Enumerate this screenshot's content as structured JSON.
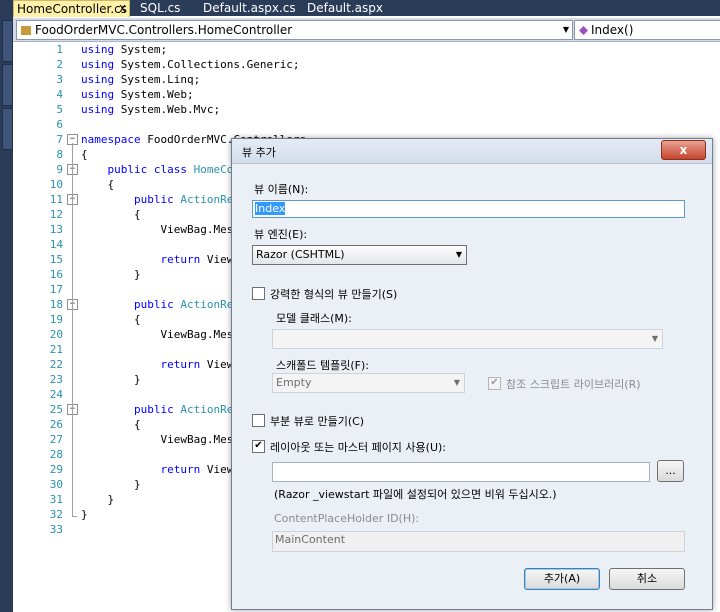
{
  "tabs": [
    {
      "label": "HomeController.cs",
      "close": "x"
    },
    {
      "label": "SQL.cs"
    },
    {
      "label": "Default.aspx.cs"
    },
    {
      "label": "Default.aspx"
    }
  ],
  "nav": {
    "class_dropdown": "FoodOrderMVC.Controllers.HomeController",
    "member_dropdown": "Index()"
  },
  "editor": {
    "lines": [
      {
        "n": "1",
        "indent": "",
        "parts": [
          {
            "t": "using",
            "c": "kw"
          },
          {
            "t": " System;"
          }
        ]
      },
      {
        "n": "2",
        "indent": "",
        "parts": [
          {
            "t": "using",
            "c": "kw"
          },
          {
            "t": " System.Collections.Generic;"
          }
        ]
      },
      {
        "n": "3",
        "indent": "",
        "parts": [
          {
            "t": "using",
            "c": "kw"
          },
          {
            "t": " System.Linq;"
          }
        ]
      },
      {
        "n": "4",
        "indent": "",
        "parts": [
          {
            "t": "using",
            "c": "kw"
          },
          {
            "t": " System.Web;"
          }
        ]
      },
      {
        "n": "5",
        "indent": "",
        "parts": [
          {
            "t": "using",
            "c": "kw"
          },
          {
            "t": " System.Web.Mvc;"
          }
        ]
      },
      {
        "n": "6",
        "indent": "",
        "parts": []
      },
      {
        "n": "7",
        "indent": "",
        "parts": [
          {
            "t": "namespace",
            "c": "kw"
          },
          {
            "t": " FoodOrderMVC.Controllers"
          }
        ]
      },
      {
        "n": "8",
        "indent": "",
        "parts": [
          {
            "t": "{"
          }
        ]
      },
      {
        "n": "9",
        "indent": "    ",
        "parts": [
          {
            "t": "public",
            "c": "kw"
          },
          {
            "t": " "
          },
          {
            "t": "class",
            "c": "kw"
          },
          {
            "t": " "
          },
          {
            "t": "HomeCo",
            "c": "ty"
          }
        ]
      },
      {
        "n": "10",
        "indent": "    ",
        "parts": [
          {
            "t": "{"
          }
        ]
      },
      {
        "n": "11",
        "indent": "        ",
        "parts": [
          {
            "t": "public",
            "c": "kw"
          },
          {
            "t": " "
          },
          {
            "t": "ActionRe",
            "c": "ty"
          }
        ]
      },
      {
        "n": "12",
        "indent": "        ",
        "parts": [
          {
            "t": "{"
          }
        ]
      },
      {
        "n": "13",
        "indent": "            ",
        "parts": [
          {
            "t": "ViewBag.Mes"
          }
        ]
      },
      {
        "n": "14",
        "indent": "",
        "parts": []
      },
      {
        "n": "15",
        "indent": "            ",
        "parts": [
          {
            "t": "return",
            "c": "kw"
          },
          {
            "t": " View"
          }
        ]
      },
      {
        "n": "16",
        "indent": "        ",
        "parts": [
          {
            "t": "}"
          }
        ]
      },
      {
        "n": "17",
        "indent": "",
        "parts": []
      },
      {
        "n": "18",
        "indent": "        ",
        "parts": [
          {
            "t": "public",
            "c": "kw"
          },
          {
            "t": " "
          },
          {
            "t": "ActionRe",
            "c": "ty"
          }
        ]
      },
      {
        "n": "19",
        "indent": "        ",
        "parts": [
          {
            "t": "{"
          }
        ]
      },
      {
        "n": "20",
        "indent": "            ",
        "parts": [
          {
            "t": "ViewBag.Mes"
          }
        ]
      },
      {
        "n": "21",
        "indent": "",
        "parts": []
      },
      {
        "n": "22",
        "indent": "            ",
        "parts": [
          {
            "t": "return",
            "c": "kw"
          },
          {
            "t": " View"
          }
        ]
      },
      {
        "n": "23",
        "indent": "        ",
        "parts": [
          {
            "t": "}"
          }
        ]
      },
      {
        "n": "24",
        "indent": "",
        "parts": []
      },
      {
        "n": "25",
        "indent": "        ",
        "parts": [
          {
            "t": "public",
            "c": "kw"
          },
          {
            "t": " "
          },
          {
            "t": "ActionRe",
            "c": "ty"
          }
        ]
      },
      {
        "n": "26",
        "indent": "        ",
        "parts": [
          {
            "t": "{"
          }
        ]
      },
      {
        "n": "27",
        "indent": "            ",
        "parts": [
          {
            "t": "ViewBag.Mes"
          }
        ]
      },
      {
        "n": "28",
        "indent": "",
        "parts": []
      },
      {
        "n": "29",
        "indent": "            ",
        "parts": [
          {
            "t": "return",
            "c": "kw"
          },
          {
            "t": " View"
          }
        ]
      },
      {
        "n": "30",
        "indent": "        ",
        "parts": [
          {
            "t": "}"
          }
        ]
      },
      {
        "n": "31",
        "indent": "    ",
        "parts": [
          {
            "t": "}"
          }
        ]
      },
      {
        "n": "32",
        "indent": "",
        "parts": [
          {
            "t": "}"
          }
        ]
      },
      {
        "n": "33",
        "indent": "",
        "parts": []
      }
    ]
  },
  "dialog": {
    "title": "뷰 추가",
    "close": "x",
    "view_name_label": "뷰 이름(N):",
    "view_name_value": "Index",
    "view_engine_label": "뷰 엔진(E):",
    "view_engine_value": "Razor (CSHTML)",
    "strongly_typed_label": "강력한 형식의 뷰 만들기(S)",
    "strongly_typed_checked": false,
    "model_class_label": "모델 클래스(M):",
    "model_class_value": "",
    "scaffold_label": "스캐폴드 템플릿(F):",
    "scaffold_value": "Empty",
    "script_libs_label": "참조 스크립트 라이브러리(R)",
    "script_libs_checked": true,
    "partial_label": "부분 뷰로 만들기(C)",
    "partial_checked": false,
    "layout_label": "레이아웃 또는 마스터 페이지 사용(U):",
    "layout_checked": true,
    "layout_path_value": "",
    "browse_label": "...",
    "layout_hint": "(Razor _viewstart 파일에 설정되어 있으면 비워 두십시오.)",
    "placeholder_label": "ContentPlaceHolder ID(H):",
    "placeholder_value": "MainContent",
    "add_button": "추가(A)",
    "cancel_button": "취소"
  },
  "colors": {
    "keyword": "#0000ff",
    "type": "#2b91af",
    "line_number": "#2b91af",
    "ide_chrome": "#2b3c59"
  }
}
